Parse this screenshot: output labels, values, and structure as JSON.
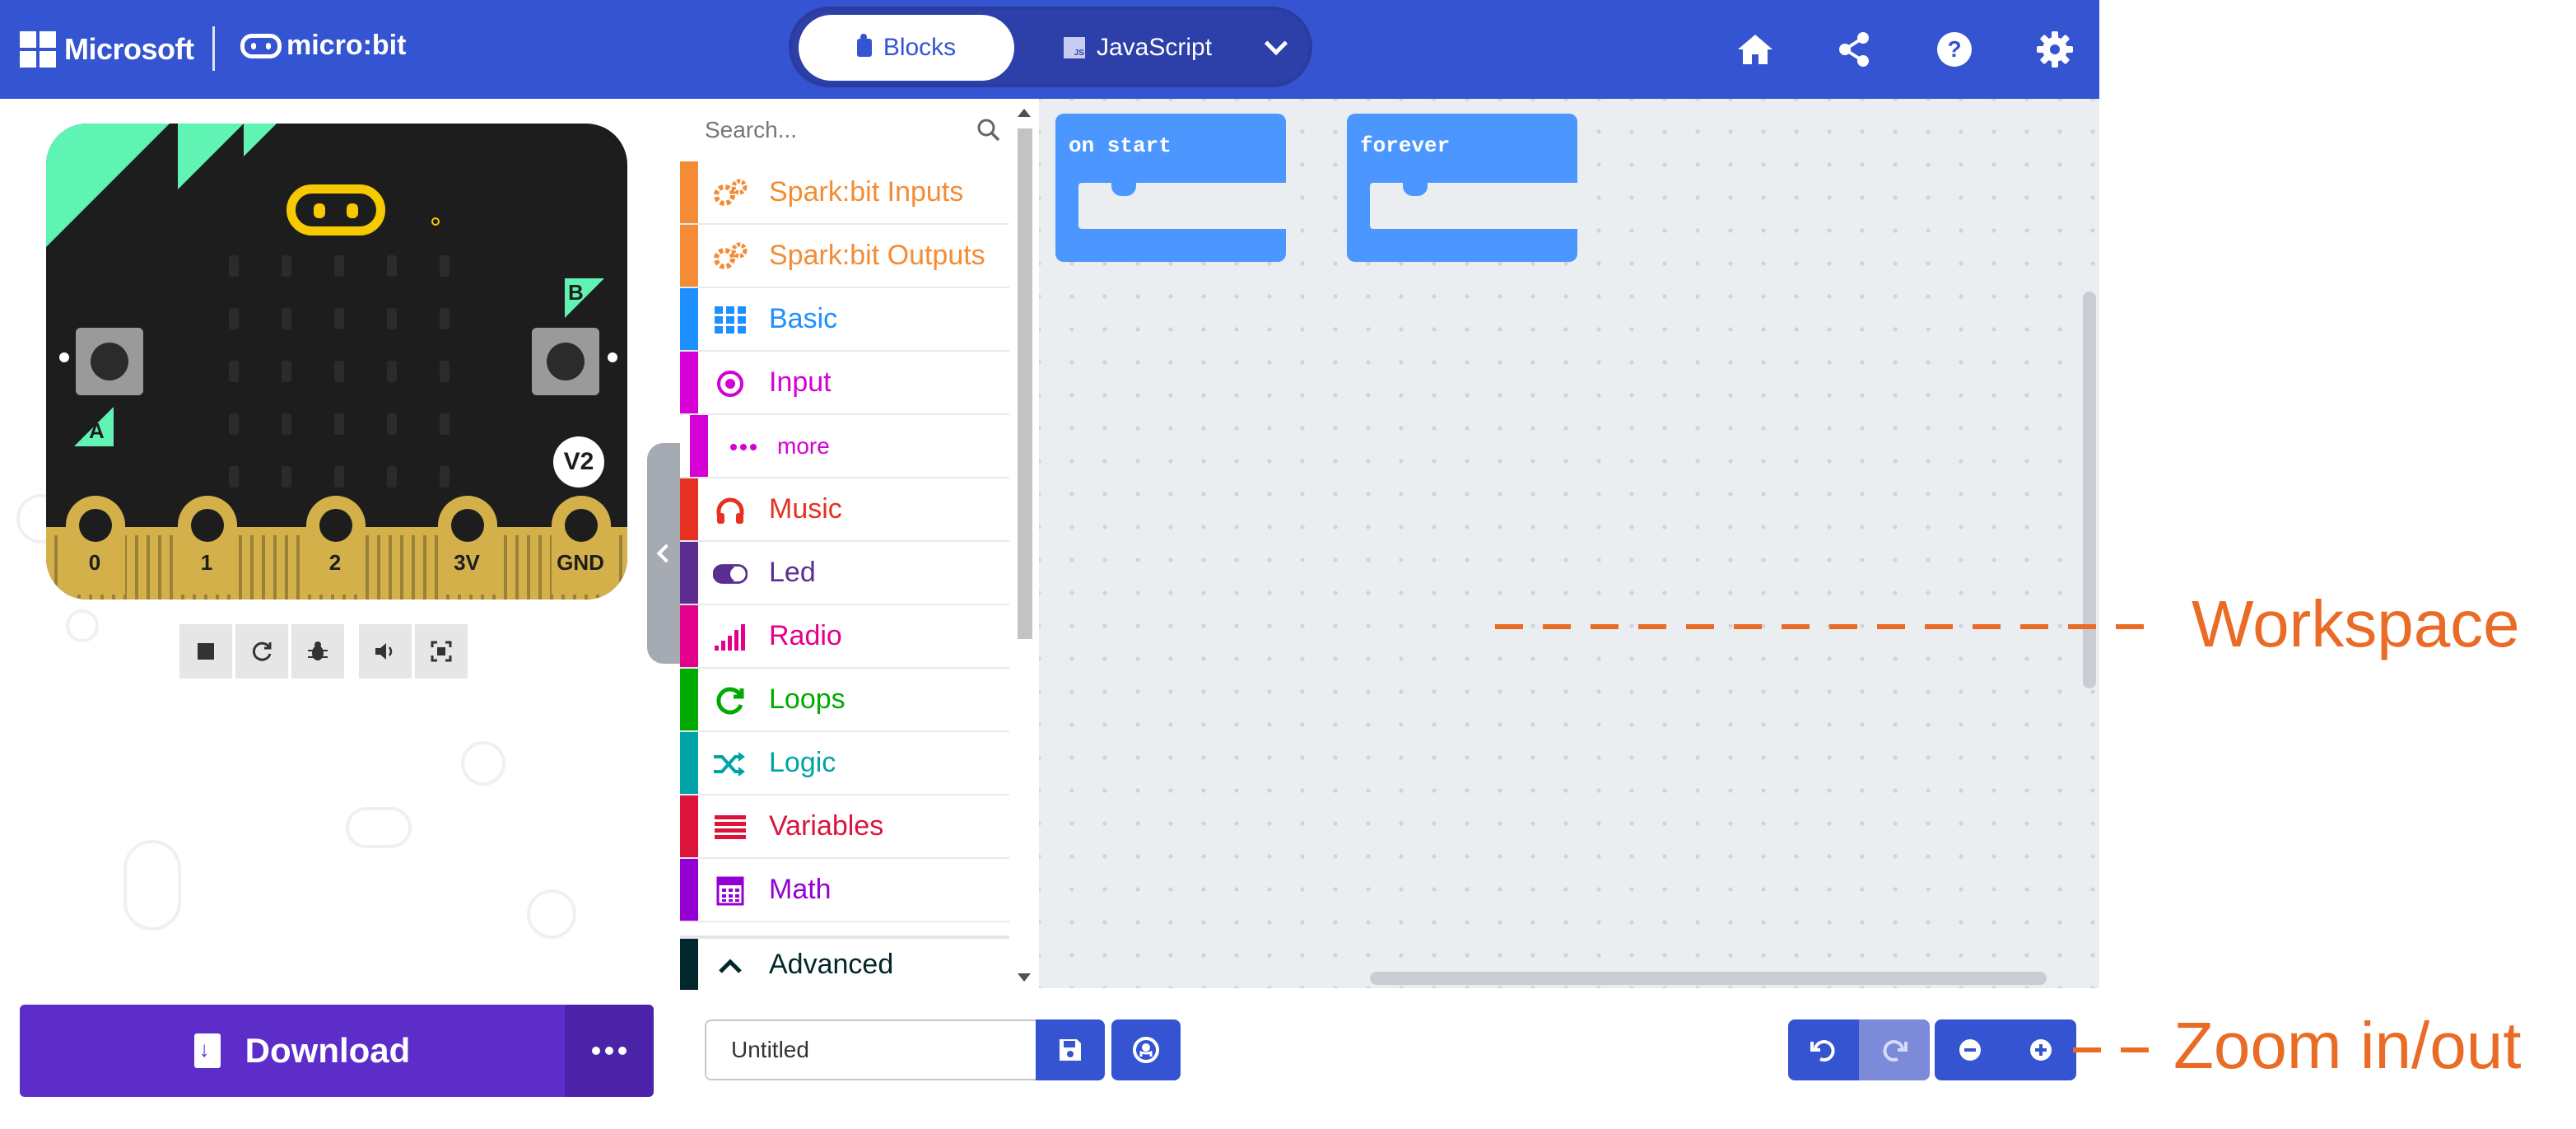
{
  "header": {
    "brand_left": "Microsoft",
    "brand_right": "micro:bit",
    "tabs": [
      {
        "label": "Blocks",
        "active": true
      },
      {
        "label": "JavaScript",
        "active": false
      }
    ],
    "icons": [
      "home-icon",
      "share-icon",
      "help-icon",
      "settings-icon"
    ]
  },
  "simulator": {
    "button_a": "A",
    "button_b": "B",
    "version_badge": "V2",
    "pins": [
      "0",
      "1",
      "2",
      "3V",
      "GND"
    ],
    "controls": [
      "stop-icon",
      "restart-icon",
      "debug-icon",
      "mute-icon",
      "fullscreen-icon"
    ]
  },
  "toolbox": {
    "search_placeholder": "Search...",
    "categories": [
      {
        "label": "Spark:bit Inputs",
        "color": "#f48c35",
        "icon": "gears-icon"
      },
      {
        "label": "Spark:bit Outputs",
        "color": "#f48c35",
        "icon": "gears-icon"
      },
      {
        "label": "Basic",
        "color": "#1e90ff",
        "icon": "grid-icon"
      },
      {
        "label": "Input",
        "color": "#d400d4",
        "icon": "target-icon"
      },
      {
        "label": "more",
        "color": "#d400d4",
        "icon": "dots-icon"
      },
      {
        "label": "Music",
        "color": "#e63022",
        "icon": "headphones-icon"
      },
      {
        "label": "Led",
        "color": "#5c2d91",
        "icon": "toggle-icon"
      },
      {
        "label": "Radio",
        "color": "#e3008c",
        "icon": "signal-icon"
      },
      {
        "label": "Loops",
        "color": "#00aa00",
        "icon": "refresh-icon"
      },
      {
        "label": "Logic",
        "color": "#00a4a6",
        "icon": "shuffle-icon"
      },
      {
        "label": "Variables",
        "color": "#dc143c",
        "icon": "list-icon"
      },
      {
        "label": "Math",
        "color": "#9400d3",
        "icon": "calculator-icon"
      }
    ],
    "advanced": {
      "label": "Advanced",
      "color": "#00272b"
    }
  },
  "workspace": {
    "blocks": [
      {
        "label": "on start"
      },
      {
        "label": "forever"
      }
    ]
  },
  "footer": {
    "download_label": "Download",
    "project_name": "Untitled",
    "zoom_buttons": [
      "undo-icon",
      "redo-icon",
      "zoom-out-icon",
      "zoom-in-icon"
    ]
  },
  "annotations": {
    "workspace_label": "Workspace",
    "zoom_label": "Zoom in/out",
    "color": "#ea6b25"
  }
}
